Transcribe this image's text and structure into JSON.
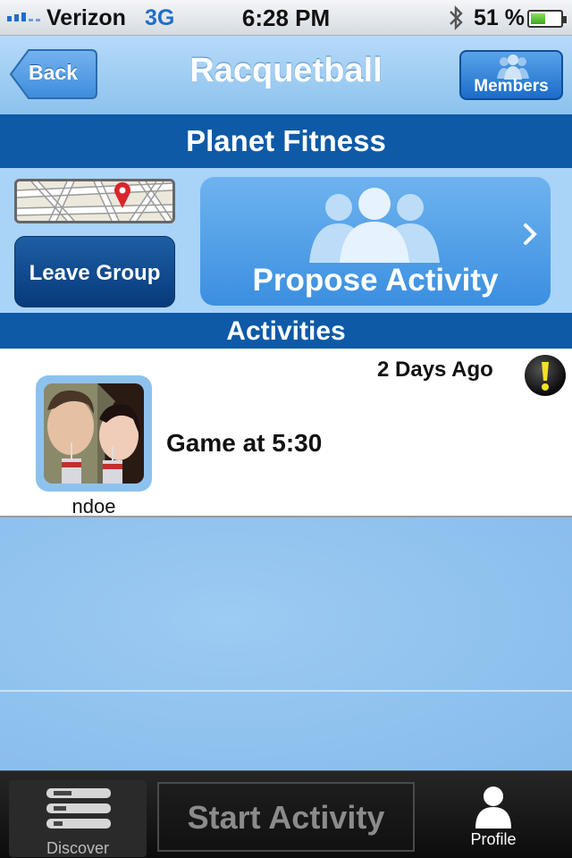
{
  "status_bar": {
    "carrier": "Verizon",
    "network": "3G",
    "time": "6:28 PM",
    "battery_percent": "51 %",
    "battery_level": 0.51,
    "icons": [
      "signal-icon",
      "bluetooth-icon",
      "battery-icon"
    ]
  },
  "navbar": {
    "back_label": "Back",
    "title": "Racquetball",
    "members_label": "Members"
  },
  "location": {
    "name": "Planet Fitness"
  },
  "actions": {
    "leave_group_label": "Leave Group",
    "propose_activity_label": "Propose Activity"
  },
  "activities": {
    "header": "Activities",
    "items": [
      {
        "username": "ndoe",
        "time_ago": "2 Days Ago",
        "title": "Game at 5:30",
        "alert_icon": "exclamation-icon"
      }
    ]
  },
  "tabbar": {
    "discover_label": "Discover",
    "start_activity_label": "Start Activity",
    "profile_label": "Profile"
  },
  "colors": {
    "accent_blue": "#0e5aa7",
    "light_blue": "#a9d3f7",
    "status_blue": "#1f6fc8"
  }
}
